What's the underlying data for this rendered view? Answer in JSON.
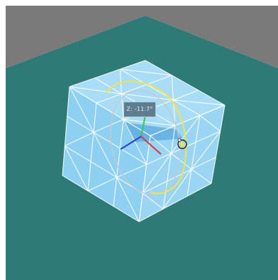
{
  "viewport": {
    "background_color": "#ffffff",
    "wall_color": "#7a7a7a",
    "floor_color": "#2e7a77",
    "floor_edge_color": "#3a8885"
  },
  "mesh": {
    "face_color_top": "#a9dcf6",
    "face_color_left": "#8ed0f2",
    "face_color_right": "#9ad6f4",
    "edge_color": "#ffffff",
    "selection_color": "#5aa8dd"
  },
  "gizmo": {
    "rotation_ring_color": "#f0e44a",
    "guide_ring_color": "#c8c8c8",
    "axis_x_color": "#e0304a",
    "axis_y_color": "#34c85a",
    "axis_z_color": "#2a3fd0",
    "handle_icon": "rotate-handle-icon"
  },
  "tooltip": {
    "text": "Z: -11.7°"
  }
}
